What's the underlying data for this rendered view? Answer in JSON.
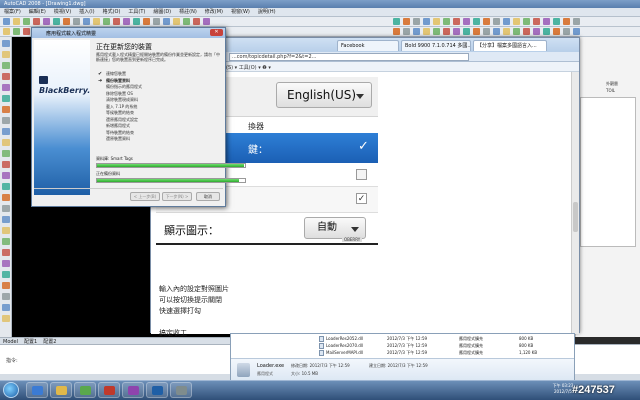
{
  "cad": {
    "title": "AutoCAD 2008 - [Drawing1.dwg]",
    "menus": [
      "檔案(F)",
      "編輯(E)",
      "檢視(V)",
      "插入(I)",
      "格式(O)",
      "工具(T)",
      "繪圖(D)",
      "標註(N)",
      "修改(M)",
      "視窗(W)",
      "說明(H)"
    ],
    "tabs": [
      "Model",
      "配置1",
      "配置2"
    ],
    "command_label": "指令:",
    "right_panel": {
      "label1": "外觀層",
      "label2": "TOIL"
    }
  },
  "browser": {
    "tabs": [
      {
        "label": "Facebook"
      },
      {
        "label": "Bold 9900 7.1.0.714 多國..."
      },
      {
        "label": "【分享】檔案多國語言入..."
      }
    ],
    "address": "...com/topicdetail.php?f=2&t=2...",
    "toolbar2_text": "安全性(S) ▾   工具(O) ▾   ❷ ▾",
    "page": {
      "language_value": "English(US)",
      "section_header": "換器",
      "blue_row_text": "鍵：",
      "display_label": "顯示圖示：",
      "display_value": "自動",
      "phone_brand": "OBERRY",
      "instructions": [
        "輸入內的設定對照圖片",
        "可以按切換提示關閉",
        "快速選擇打勾"
      ],
      "instructions_done": "搞定收工"
    }
  },
  "dialog": {
    "title": "應用程式載入程式精靈",
    "close": "✕",
    "brand": "BlackBerry.",
    "heading": "正在更新您的裝置",
    "description": "應用程式載入程式精靈已經開始裝置的備份作業並更新設定，請勿「中斷連接」您的裝置直到更新程序已完成。",
    "steps": [
      {
        "mark": "✔",
        "label": "連線您裝置",
        "state": "done"
      },
      {
        "mark": "➜",
        "label": "備份裝置資料",
        "state": "active"
      },
      {
        "mark": "",
        "label": "備份指示的應用程式",
        "state": "pending"
      },
      {
        "mark": "",
        "label": "移除您裝置 OS",
        "state": "pending"
      },
      {
        "mark": "",
        "label": "清除裝置現成資料",
        "state": "pending"
      },
      {
        "mark": "",
        "label": "載入 7.1P 的系統",
        "state": "pending"
      },
      {
        "mark": "",
        "label": "等候裝置的結束",
        "state": "pending"
      },
      {
        "mark": "",
        "label": "還原應用程式設定",
        "state": "pending"
      },
      {
        "mark": "",
        "label": "新增應用程式",
        "state": "pending"
      },
      {
        "mark": "",
        "label": "等待裝置的結束",
        "state": "pending"
      },
      {
        "mark": "",
        "label": "還原裝置資料",
        "state": "pending"
      }
    ],
    "data_label": "資料庫: Smart Tags",
    "progress1": 0.99,
    "status_label": "正在備份資料",
    "progress2": 0.96,
    "buttons": {
      "back": "< 上一步(B)",
      "next": "下一步(N) >",
      "cancel": "取消"
    }
  },
  "explorer": {
    "files": [
      {
        "name": "LoaderRes2052.dll",
        "date": "2012/7/3 下午 12:59",
        "type": "應用程式擴充",
        "size": "800 KB"
      },
      {
        "name": "LoaderRes2070.dll",
        "date": "2012/7/3 下午 12:59",
        "type": "應用程式擴充",
        "size": "800 KB"
      },
      {
        "name": "MailServerMAPI.dll",
        "date": "2012/7/3 下午 12:59",
        "type": "應用程式擴充",
        "size": "1,120 KB"
      }
    ],
    "details": {
      "name": "Loader.exe",
      "type": "應用程式",
      "modified": "修改日期: 2012/7/3 下午 12:59",
      "size": "大小: 10.5 MB",
      "created": "建立日期: 2012/7/3 下午 12:59"
    }
  },
  "taskbar": {
    "time": "下午 03:23 2012/7/5",
    "watermark": "#247537"
  },
  "colors": {
    "dialog_accent": "#1f5fa6",
    "selected_row": "#2e7fd6",
    "progress": "#2eaa2e"
  }
}
